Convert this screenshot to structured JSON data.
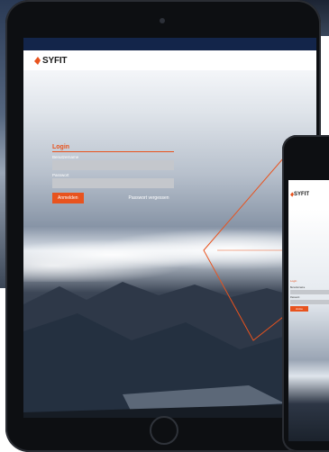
{
  "tablet": {
    "brand": "SYFIT",
    "login": {
      "title": "Login",
      "username_label": "Benutzername",
      "username_value": "",
      "password_label": "Passwort",
      "password_value": "",
      "submit_label": "Anmelden",
      "forgot_label": "Passwort vergessen"
    }
  },
  "phone": {
    "brand": "SYFIT",
    "login": {
      "title": "Login",
      "username_label": "Benutzername",
      "password_label": "Passwort",
      "submit_label": "Anme"
    }
  },
  "colors": {
    "accent": "#e8531e",
    "topbar": "#13254a",
    "input": "#c4c7cc"
  }
}
